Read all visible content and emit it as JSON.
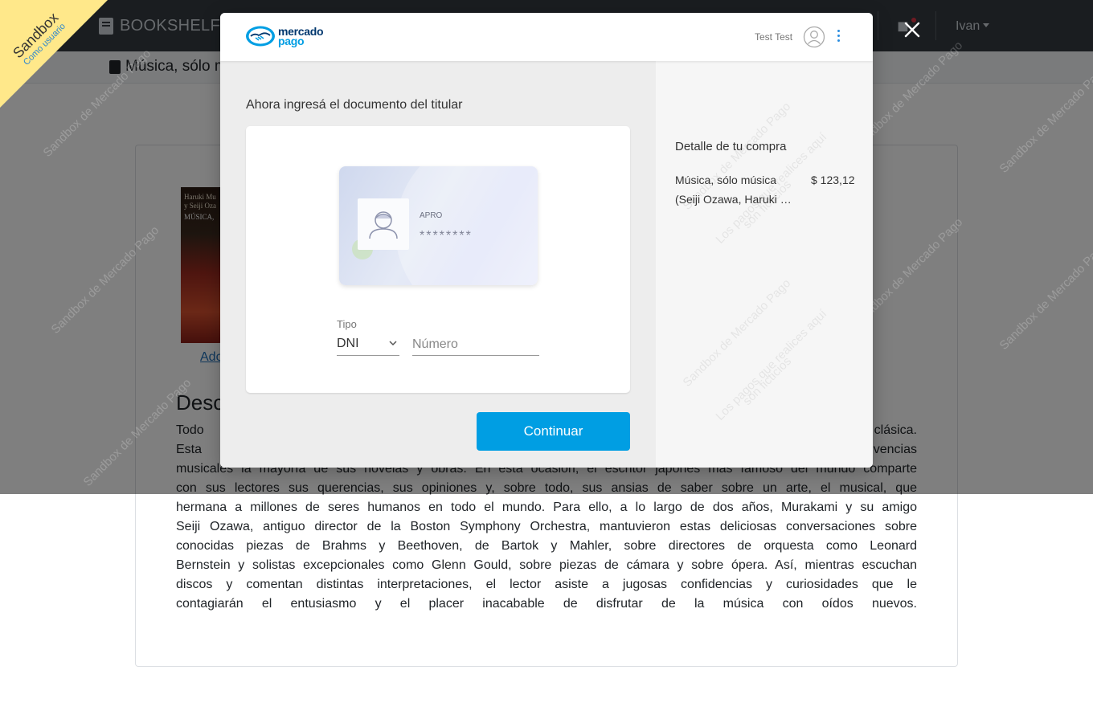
{
  "navbar": {
    "brand": "BOOKSHELF",
    "user": "Ivan"
  },
  "breadcrumb": {
    "title": "Música, sólo m"
  },
  "book": {
    "cover_line1": "Haruki Mu",
    "cover_line2": "y Seiji Oza",
    "cover_title": "MÚSICA,",
    "add_link": "Ado",
    "description_title": "Desc",
    "description_lines": [
      "Todo e                                                                                                                              clásica.",
      "Esta pa                                                                                                                          vencias",
      "musicales la mayoría de sus novelas y obras. En esta ocasión, el escritor japonés más famoso del mundo comparte",
      "con sus lectores sus querencias, sus opiniones y, sobre todo, sus ansias de saber sobre un arte, el musical, que",
      "hermana a millones de seres humanos en todo el mundo. Para ello, a lo largo de dos años, Murakami y su amigo",
      "Seiji Ozawa, antiguo director de la Boston Symphony Orchestra, mantuvieron estas deliciosas conversaciones sobre",
      "conocidas piezas de Brahms y Beethoven, de Bartok y Mahler, sobre directores de orquesta como Leonard",
      "Bernstein y solistas excepcionales como Glenn Gould, sobre piezas de cámara y sobre ópera. Así, mientras escuchan",
      "discos y comentan distintas interpretaciones, el lector asiste a jugosas confidencias y curiosidades que le",
      "contagiarán el entusiasmo y el placer inacabable de disfrutar de la música con oídos nuevos."
    ]
  },
  "ribbon": {
    "title": "Sandbox",
    "subtitle": "Como usuario"
  },
  "watermark": {
    "line1": "Sandbox de Mercado Pago",
    "line2": "Los pagos que realices aquí",
    "line3": "son ficticios"
  },
  "checkout": {
    "logo_line1": "mercado",
    "logo_line2": "pago",
    "test_user": "Test Test",
    "step_title": "Ahora ingresá el documento del titular",
    "card_name": "APRO",
    "card_number": "********",
    "doc_type_label": "Tipo",
    "doc_type_value": "DNI",
    "doc_number_placeholder": "Número",
    "doc_number_value": "",
    "continue_label": "Continuar",
    "summary_title": "Detalle de tu compra",
    "item_line1": "Música, sólo música",
    "item_line2": "(Seiji Ozawa, Haruki Murakami)",
    "item_price": "$ 123,12"
  },
  "colors": {
    "accent": "#009ee3",
    "navbar": "#343a40",
    "ribbon": "#ffe88a"
  },
  "icons": {
    "close": "close-icon",
    "user": "user-circle-icon",
    "menu": "kebab-icon",
    "bell": "bell-icon"
  }
}
